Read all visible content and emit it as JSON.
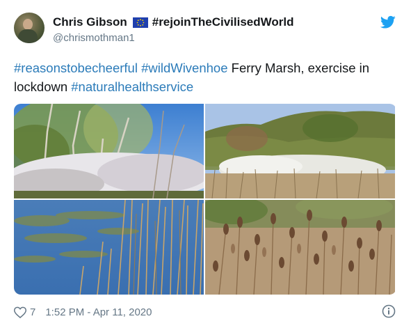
{
  "author": {
    "display_name": "Chris Gibson",
    "flag_icon": "eu-flag-icon",
    "name_suffix": "#rejoinTheCivilisedWorld",
    "handle": "@chrismothman1",
    "avatar_icon": "avatar"
  },
  "tweet": {
    "text_parts": {
      "tag1": "#reasonstobecheerful",
      "tag2": "#wildWivenhoe",
      "plain1": " Ferry Marsh, exercise in lockdown ",
      "tag3": "#naturalhealthservice"
    },
    "media": [
      {
        "name": "photo-birch-trees-blossom"
      },
      {
        "name": "photo-wooded-hill-blossom"
      },
      {
        "name": "photo-pond-reeds"
      },
      {
        "name": "photo-teasels"
      }
    ]
  },
  "footer": {
    "likes": "7",
    "timestamp": "1:52 PM - Apr 11, 2020"
  },
  "colors": {
    "twitter_blue": "#1da1f2",
    "hashtag_blue": "#2b7bb9",
    "secondary_text": "#657786",
    "primary_text": "#14171a"
  }
}
